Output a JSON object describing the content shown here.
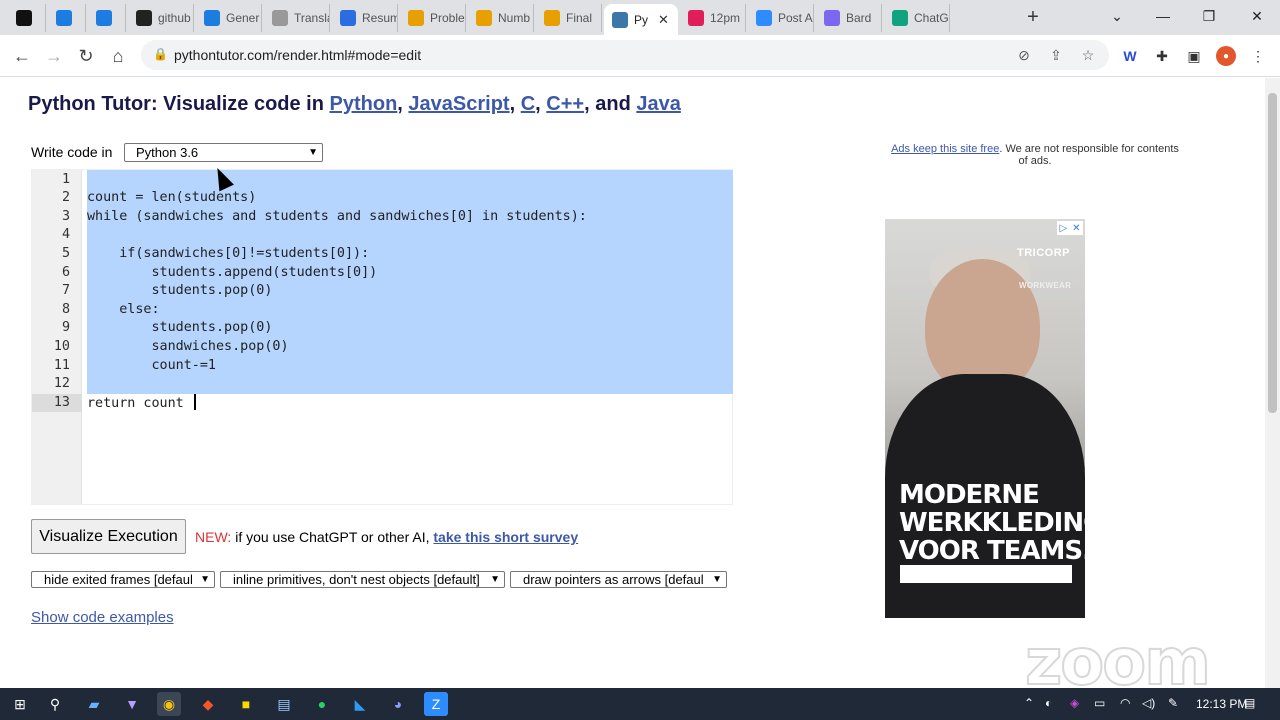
{
  "browser": {
    "tabs": [
      {
        "label": "",
        "icon": "gmail-icon",
        "color": "#111"
      },
      {
        "label": "",
        "icon": "k-icon",
        "color": "#1d7ce0"
      },
      {
        "label": "",
        "icon": "k-icon",
        "color": "#1d7ce0"
      },
      {
        "label": "github",
        "icon": "github-icon",
        "color": "#222"
      },
      {
        "label": "Gener",
        "icon": "k-icon",
        "color": "#1d7ce0"
      },
      {
        "label": "Transla",
        "icon": "globe-icon",
        "color": "#999"
      },
      {
        "label": "Resum",
        "icon": "doc-icon",
        "color": "#2b6de0"
      },
      {
        "label": "Proble",
        "icon": "leetcode-icon",
        "color": "#e8a000"
      },
      {
        "label": "Numb",
        "icon": "leetcode-icon",
        "color": "#e8a000"
      },
      {
        "label": "Final",
        "icon": "leetcode-icon",
        "color": "#e8a000"
      },
      {
        "label": "Py",
        "icon": "python-icon",
        "color": "#3b77a8"
      },
      {
        "label": "12pm",
        "icon": "slack-icon",
        "color": "#e01e5a"
      },
      {
        "label": "Post A",
        "icon": "zoom-icon",
        "color": "#2d8cff"
      },
      {
        "label": "Bard",
        "icon": "bard-icon",
        "color": "#7b68ee"
      },
      {
        "label": "ChatG",
        "icon": "chatgpt-icon",
        "color": "#10a37f"
      }
    ],
    "url": "pythontutor.com/render.html#mode=edit"
  },
  "page": {
    "title_prefix": "Python Tutor: Visualize code in ",
    "title_links": [
      "Python",
      "JavaScript",
      "C",
      "C++",
      "Java"
    ],
    "title_sep1": ", ",
    "title_sep2": ", ",
    "title_sep3": ", ",
    "title_sep4": ", and ",
    "write_label": "Write code in",
    "language": "Python 3.6",
    "code_lines": [
      "",
      "count = len(students)",
      "while (sandwiches and students and sandwiches[0] in students):",
      "",
      "    if(sandwiches[0]!=students[0]):",
      "        students.append(students[0])",
      "        students.pop(0)",
      "    else:",
      "        students.pop(0)",
      "        sandwiches.pop(0)",
      "        count-=1",
      "",
      "return count "
    ],
    "line_numbers": [
      "1",
      "2",
      "3",
      "4",
      "5",
      "6",
      "7",
      "8",
      "9",
      "10",
      "11",
      "12",
      "13"
    ],
    "visualize_button": "Visualize Execution",
    "survey_new": "NEW:",
    "survey_text": " if you use ChatGPT or other AI, ",
    "survey_link": "take this short survey",
    "options": [
      "hide exited frames [defaul",
      "inline primitives, don't nest objects [default]",
      "draw pointers as arrows [defaul"
    ],
    "show_examples": "Show code examples",
    "ads_link": "Ads keep this site free",
    "ads_text": ". We are not responsible for contents of ads."
  },
  "ad": {
    "brand": "TRICORP",
    "brand_sub": "WORKWEAR",
    "headline": [
      "MODERNE",
      "WERKKLEDING",
      "VOOR TEAMS."
    ]
  },
  "watermark": "zoom",
  "taskbar": {
    "time": "12:13 PM"
  }
}
